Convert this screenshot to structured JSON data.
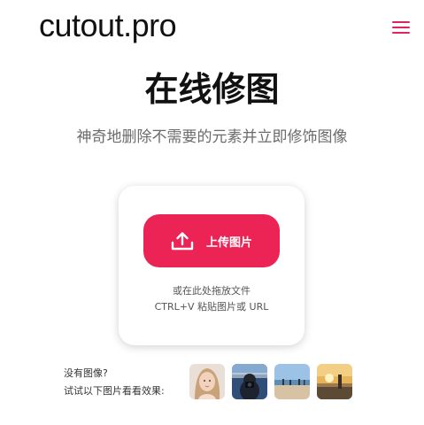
{
  "header": {
    "logo": "cutout.pro",
    "menu_icon": "hamburger-menu-icon"
  },
  "hero": {
    "title": "在线修图",
    "subtitle": "神奇地删除不需要的元素并立即修饰图像"
  },
  "upload": {
    "button_label": "上传图片",
    "icon": "upload-icon",
    "drop_hint_line1": "或在此处拖放文件",
    "drop_hint_line2": "CTRL+V 粘贴图片或 URL"
  },
  "samples": {
    "line1": "没有图像?",
    "line2": "试试以下图片看看效果:",
    "items": [
      {
        "name": "sample-woman-portrait"
      },
      {
        "name": "sample-person-camera"
      },
      {
        "name": "sample-beach-people"
      },
      {
        "name": "sample-sunset-scene"
      }
    ]
  },
  "colors": {
    "accent": "#ec2456",
    "menu": "#e0245e"
  }
}
